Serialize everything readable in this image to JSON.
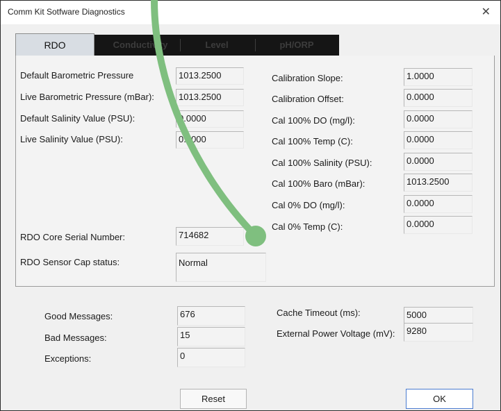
{
  "window": {
    "title": "Comm Kit Sotfware Diagnostics",
    "close_glyph": "✕"
  },
  "tabs": [
    {
      "label": "RDO",
      "active": true
    },
    {
      "label": "Conductivity",
      "active": false
    },
    {
      "label": "Level",
      "active": false
    },
    {
      "label": "pH/ORP",
      "active": false
    }
  ],
  "left_fields": [
    {
      "label": "Default Barometric Pressure",
      "value": "1013.2500"
    },
    {
      "label": "Live Barometric Pressure (mBar):",
      "value": "1013.2500"
    },
    {
      "label": "Default Salinity Value (PSU):",
      "value": "0.0000"
    },
    {
      "label": "Live Salinity Value (PSU):",
      "value": "0.0000"
    }
  ],
  "right_fields": [
    {
      "label": "Calibration Slope:",
      "value": "1.0000"
    },
    {
      "label": "Calibration Offset:",
      "value": "0.0000"
    },
    {
      "label": "Cal 100% DO (mg/l):",
      "value": "0.0000"
    },
    {
      "label": "Cal 100% Temp (C):",
      "value": "0.0000"
    },
    {
      "label": "Cal 100% Salinity (PSU):",
      "value": "0.0000"
    },
    {
      "label": "Cal 100% Baro (mBar):",
      "value": "1013.2500"
    },
    {
      "label": "Cal 0% DO (mg/l):",
      "value": "0.0000"
    },
    {
      "label": "Cal 0% Temp (C):",
      "value": "0.0000"
    }
  ],
  "core": {
    "serial_label": "RDO Core Serial Number:",
    "serial_value": "714682",
    "cap_label": "RDO Sensor Cap status:",
    "cap_value": "Normal"
  },
  "stats": [
    {
      "label": "Good Messages:",
      "value": "676"
    },
    {
      "label": "Bad Messages:",
      "value": "15"
    },
    {
      "label": "Exceptions:",
      "value": "0"
    }
  ],
  "power": [
    {
      "label": "Cache Timeout (ms):",
      "value": "5000"
    },
    {
      "label": "External Power Voltage (mV):",
      "value": "9280"
    }
  ],
  "buttons": {
    "reset": "Reset",
    "ok": "OK"
  },
  "colors": {
    "annotation_arrow": "#7fbf7f"
  }
}
